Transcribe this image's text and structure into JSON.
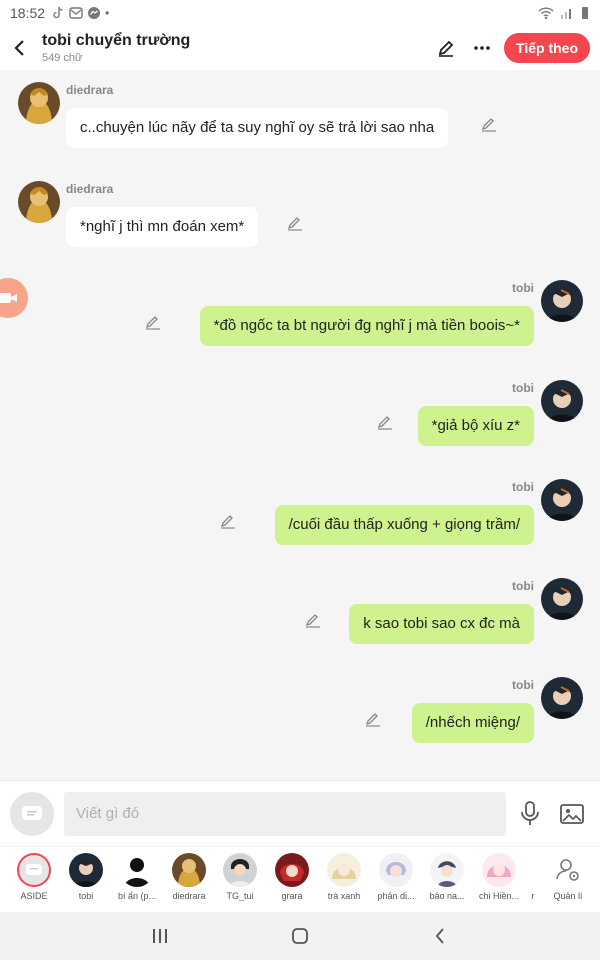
{
  "status_bar": {
    "time": "18:52"
  },
  "header": {
    "title": "tobi chuyển trường",
    "subtitle": "549 chữ",
    "follow_label": "Tiếp theo",
    "accent": "#f5454f"
  },
  "messages": [
    {
      "sender": "diedrara",
      "side": "left",
      "text": "c..chuyện lúc nãy để ta suy nghĩ oy sẽ trả lời sao nha"
    },
    {
      "sender": "diedrara",
      "side": "left",
      "text": "*nghĩ j thì mn đoán xem*"
    },
    {
      "sender": "tobi",
      "side": "right",
      "text": "*đồ ngốc ta bt người đg nghĩ j mà tiền boois~*"
    },
    {
      "sender": "tobi",
      "side": "right",
      "text": "*giả bộ xíu z*"
    },
    {
      "sender": "tobi",
      "side": "right",
      "text": "/cuối đầu thấp xuống + giọng trầm/"
    },
    {
      "sender": "tobi",
      "side": "right",
      "text": "k sao tobi sao cx đc mà"
    },
    {
      "sender": "tobi",
      "side": "right",
      "text": "/nhếch miệng/"
    }
  ],
  "composer": {
    "placeholder": "Viết gì đó"
  },
  "characters": [
    {
      "label": "ASIDE",
      "icon": "aside-icon"
    },
    {
      "label": "tobi",
      "icon": "avatar"
    },
    {
      "label": "bí ẩn (p...",
      "icon": "silhouette-icon"
    },
    {
      "label": "diedrara",
      "icon": "avatar"
    },
    {
      "label": "TG_tui",
      "icon": "avatar"
    },
    {
      "label": "grara",
      "icon": "avatar"
    },
    {
      "label": "trà xanh",
      "icon": "avatar"
    },
    {
      "label": "phản di...",
      "icon": "avatar"
    },
    {
      "label": "bảo na...",
      "icon": "avatar"
    },
    {
      "label": "chi Hiền...",
      "icon": "avatar"
    },
    {
      "label": "r",
      "icon": ""
    },
    {
      "label": "Quản lí",
      "icon": "manage-icon"
    }
  ],
  "colors": {
    "right_bubble": "#cdf28e",
    "left_bubble": "#ffffff",
    "background": "#f5f5f5"
  }
}
